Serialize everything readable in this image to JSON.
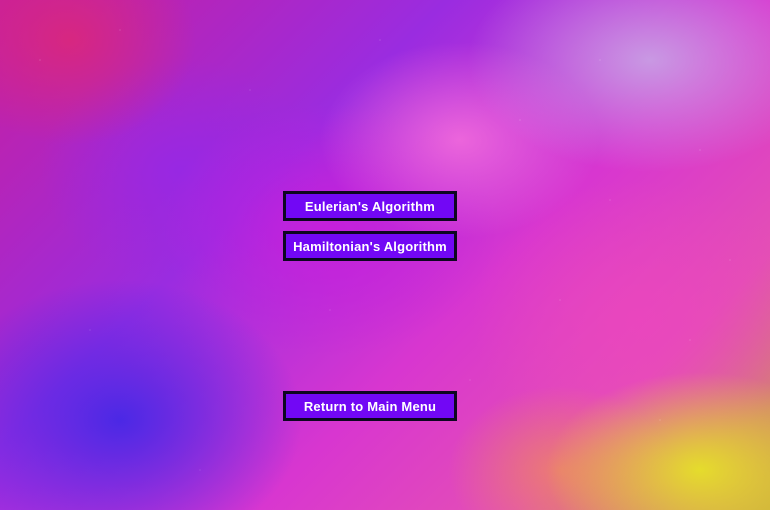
{
  "colors": {
    "button_fill": "#7207f5",
    "button_border": "#0d0620",
    "button_text": "#ffffff"
  },
  "menu": {
    "eulerian_label": "Eulerian's Algorithm",
    "hamiltonian_label": "Hamiltonian's Algorithm",
    "return_label": "Return to Main Menu"
  }
}
